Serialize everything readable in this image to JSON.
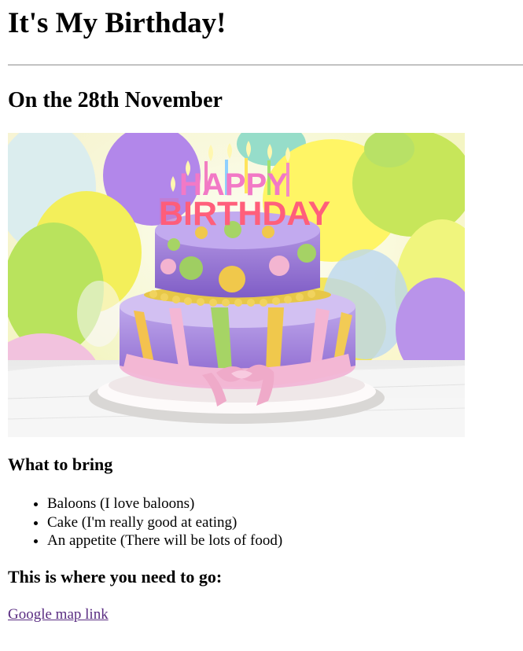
{
  "page": {
    "title": "It's My Birthday!",
    "date_heading": "On the 28th November"
  },
  "image": {
    "subject": "Birthday cake with HAPPY BIRTHDAY candles",
    "candle_text_top": "HAPPY",
    "candle_text_bottom": "BIRTHDAY",
    "colors": {
      "background": "#f3f5c2",
      "balloon_yellow": "#ecef55",
      "balloon_green": "#b9e35d",
      "balloon_purple": "#b48be8",
      "balloon_pink": "#f4b7d8",
      "cake_purple": "#9a79d6",
      "cake_pink": "#f3b6d3",
      "cake_green": "#a6cf67",
      "cake_yellow": "#f0c94c",
      "plate": "#f7f1f2"
    }
  },
  "bring": {
    "heading": "What to bring",
    "items": [
      "Baloons (I love baloons)",
      "Cake (I'm really good at eating)",
      "An appetite (There will be lots of food)"
    ]
  },
  "location": {
    "heading": "This is where you need to go:",
    "link_text": "Google map link"
  }
}
